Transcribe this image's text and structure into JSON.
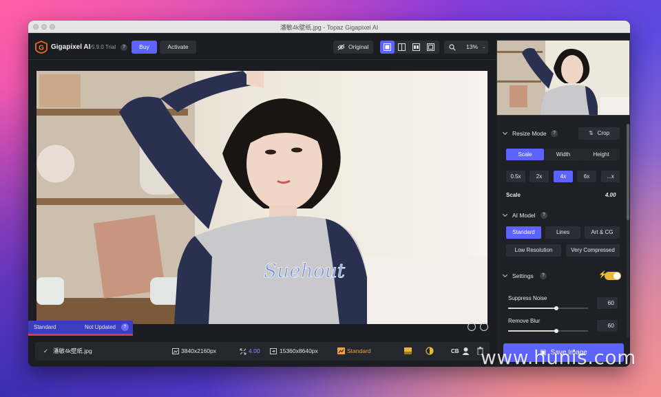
{
  "window": {
    "title": "潘敏4k壁纸.jpg - Topaz Gigapixel AI"
  },
  "header": {
    "app_name": "Gigapixel AI",
    "version": "v5.9.0 Trial",
    "help": "?",
    "buy_label": "Buy",
    "activate_label": "Activate",
    "original_label": "Original",
    "zoom_value": "13%"
  },
  "status": {
    "model": "Standard",
    "state": "Not Updated",
    "help": "?"
  },
  "filebar": {
    "filename": "潘敏4k壁纸.jpg",
    "input_size": "3840x2160px",
    "scale": "4.00",
    "output_size": "15360x8640px",
    "model": "Standard",
    "cb_label": "CB"
  },
  "panel": {
    "resize_mode": {
      "heading": "Resize Mode",
      "help": "?",
      "crop_label": "Crop",
      "tabs": [
        "Scale",
        "Width",
        "Height"
      ],
      "scales": [
        "0.5x",
        "2x",
        "4x",
        "6x",
        "...x"
      ],
      "scale_label": "Scale",
      "scale_value": "4.00"
    },
    "ai_model": {
      "heading": "AI Model",
      "help": "?",
      "options": [
        "Standard",
        "Lines",
        "Art & CG",
        "Low Resolution",
        "Very Compressed"
      ]
    },
    "settings": {
      "heading": "Settings",
      "help": "?",
      "toggle_on": true,
      "suppress_noise_label": "Suppress Noise",
      "suppress_noise_value": "60",
      "suppress_noise_level": 0.6,
      "remove_blur_label": "Remove Blur",
      "remove_blur_value": "60",
      "remove_blur_level": 0.6
    },
    "save_label": "Save Image"
  },
  "watermark": "www.hunis.com",
  "colors": {
    "accent": "#5c63ff",
    "highlight": "#f2a23a",
    "toggle": "#e6b93a",
    "status_bar": "#3a3dbd",
    "status_line": "#e03a3a"
  }
}
